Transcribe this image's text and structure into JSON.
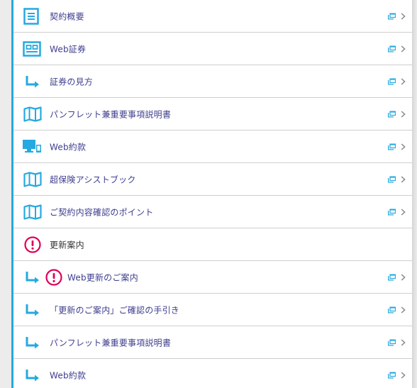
{
  "menu": {
    "items": [
      {
        "label": "契約概要",
        "icon": "document-list-icon"
      },
      {
        "label": "Web証券",
        "icon": "id-card-icon"
      },
      {
        "label": "証券の見方",
        "icon": "arrow-sub-icon"
      },
      {
        "label": "パンフレット兼重要事項説明書",
        "icon": "map-icon"
      },
      {
        "label": "Web約款",
        "icon": "devices-icon"
      },
      {
        "label": "超保険アシストブック",
        "icon": "map-icon"
      },
      {
        "label": "ご契約内容確認のポイント",
        "icon": "map-icon"
      },
      {
        "label": "更新案内",
        "icon": "alert-icon"
      },
      {
        "label": "Web更新のご案内",
        "icon": "alert-icon"
      },
      {
        "label": "「更新のご案内」ご確認の手引き",
        "icon": "arrow-sub-icon"
      },
      {
        "label": "パンフレット兼重要事項説明書",
        "icon": "arrow-sub-icon"
      },
      {
        "label": "Web約款",
        "icon": "arrow-sub-icon"
      }
    ]
  },
  "colors": {
    "accent": "#25a9e0",
    "alert": "#e0005a",
    "link_text": "#3d3d8f"
  }
}
